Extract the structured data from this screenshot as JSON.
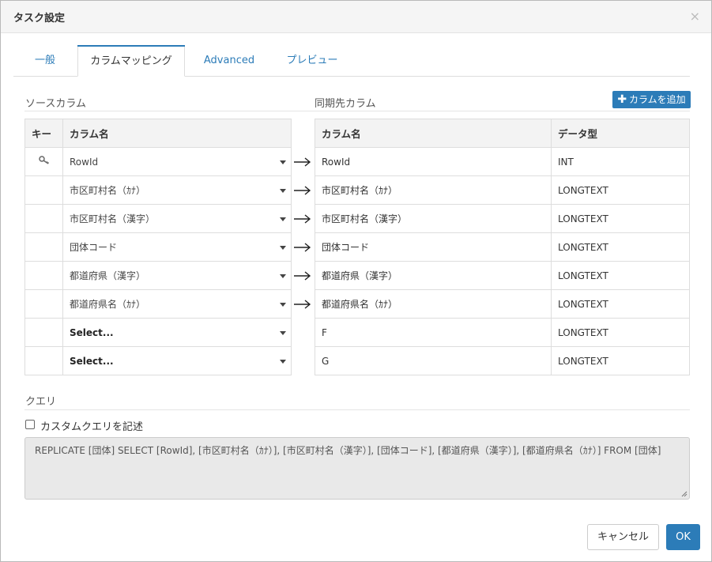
{
  "dialog": {
    "title": "タスク設定",
    "close_icon": "×"
  },
  "tabs": [
    {
      "label": "一般",
      "active": false
    },
    {
      "label": "カラムマッピング",
      "active": true
    },
    {
      "label": "Advanced",
      "active": false
    },
    {
      "label": "プレビュー",
      "active": false
    }
  ],
  "sections": {
    "source": "ソースカラム",
    "target": "同期先カラム",
    "query": "クエリ"
  },
  "add_column_label": "カラムを追加",
  "source_table": {
    "headers": [
      "キー",
      "カラム名"
    ],
    "rows": [
      {
        "key": true,
        "column": "RowId"
      },
      {
        "key": false,
        "column": "市区町村名（ｶﾅ）"
      },
      {
        "key": false,
        "column": "市区町村名（漢字）"
      },
      {
        "key": false,
        "column": "団体コード"
      },
      {
        "key": false,
        "column": "都道府県（漢字）"
      },
      {
        "key": false,
        "column": "都道府県名（ｶﾅ）"
      },
      {
        "key": false,
        "column": "Select..."
      },
      {
        "key": false,
        "column": "Select..."
      }
    ]
  },
  "target_table": {
    "headers": [
      "カラム名",
      "データ型"
    ],
    "rows": [
      {
        "column": "RowId",
        "type": "INT"
      },
      {
        "column": "市区町村名（ｶﾅ）",
        "type": "LONGTEXT"
      },
      {
        "column": "市区町村名（漢字）",
        "type": "LONGTEXT"
      },
      {
        "column": "団体コード",
        "type": "LONGTEXT"
      },
      {
        "column": "都道府県（漢字）",
        "type": "LONGTEXT"
      },
      {
        "column": "都道府県名（ｶﾅ）",
        "type": "LONGTEXT"
      },
      {
        "column": "F",
        "type": "LONGTEXT"
      },
      {
        "column": "G",
        "type": "LONGTEXT"
      }
    ]
  },
  "custom_query": {
    "checkbox_label": "カスタムクエリを記述",
    "checked": false
  },
  "query_text": "REPLICATE [団体] SELECT [RowId], [市区町村名（ｶﾅ）], [市区町村名（漢字）], [団体コード], [都道府県（漢字）], [都道府県名（ｶﾅ）] FROM [団体]",
  "buttons": {
    "cancel": "キャンセル",
    "ok": "OK"
  },
  "colors": {
    "accent": "#2c7cb8"
  }
}
